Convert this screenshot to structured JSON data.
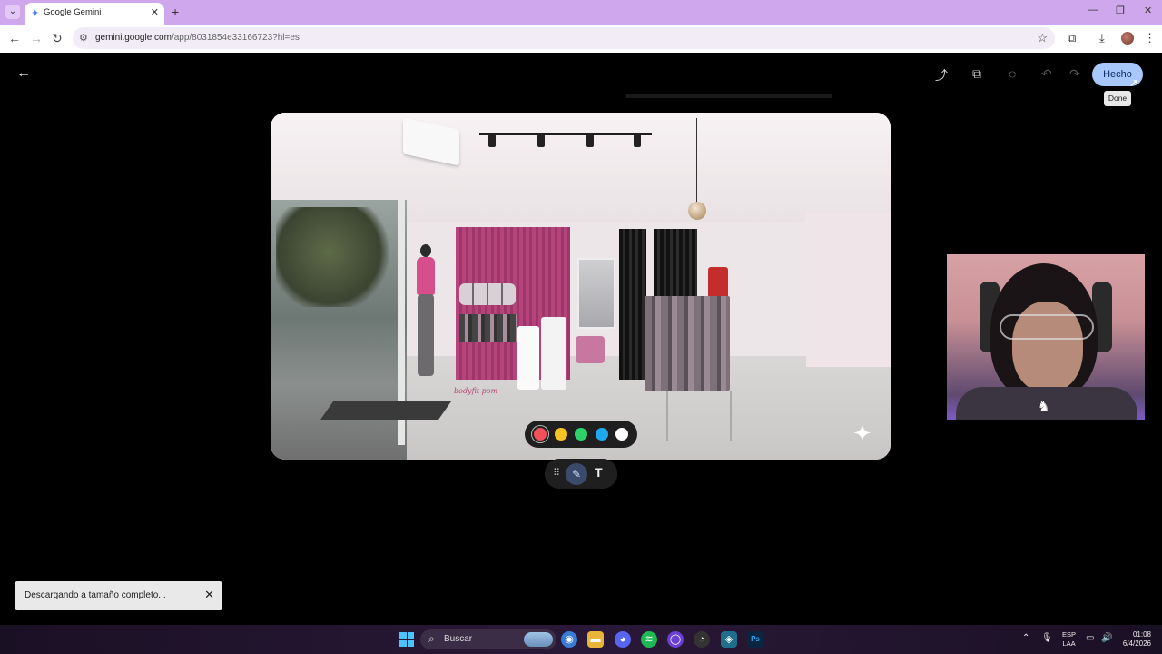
{
  "browser": {
    "tab_title": "Google Gemini",
    "url_host": "gemini.google.com",
    "url_path": "/app/8031854e33166723?hl=es"
  },
  "editor": {
    "done_label": "Hecho",
    "tooltip": "Done",
    "brand_text": "bodyfit pom",
    "palette_colors": [
      "#f25159",
      "#f7c325",
      "#2fd16b",
      "#1fa9ee",
      "#ffffff"
    ],
    "selected_color": "#f25159",
    "toast": "Descargando a tamaño completo...",
    "icons": [
      "back-arrow-icon",
      "share-icon",
      "copy-icon",
      "loading-icon",
      "undo-icon",
      "redo-icon",
      "grip-icon",
      "pen-icon",
      "text-icon",
      "sparkle-icon"
    ]
  },
  "taskbar": {
    "search_label": "Buscar",
    "lang_line1": "ESP",
    "lang_line2": "LAA",
    "time": "01:08",
    "date": "6/4/2026"
  }
}
